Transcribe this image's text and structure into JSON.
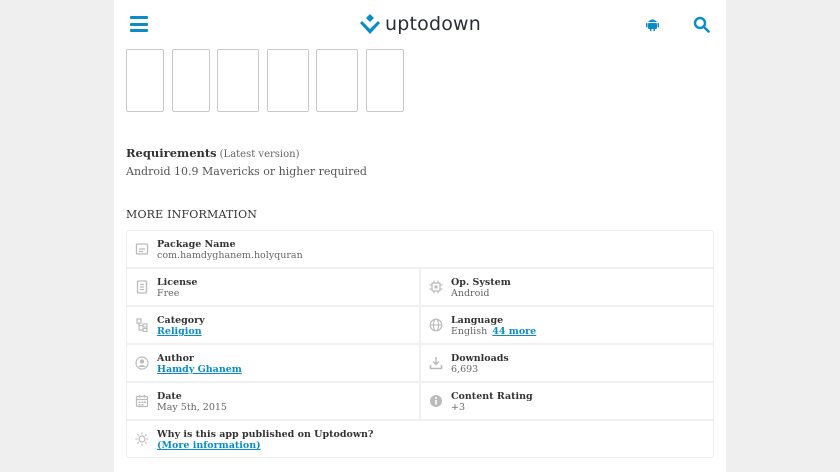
{
  "header": {
    "logo_text": "uptodown",
    "accent_color": "#0a8dc7"
  },
  "screenshots_count": 6,
  "requirements": {
    "title": "Requirements",
    "subtitle": "(Latest version)",
    "text": "Android 10.9 Mavericks or higher required"
  },
  "more_info": {
    "title": "MORE INFORMATION",
    "package_label": "Package Name",
    "package_value": "com.hamdyghanem.holyquran",
    "license_label": "License",
    "license_value": "Free",
    "os_label": "Op. System",
    "os_value": "Android",
    "category_label": "Category",
    "category_value": "Religion",
    "language_label": "Language",
    "language_value": "English",
    "language_more": "44 more",
    "author_label": "Author",
    "author_value": "Hamdy Ghanem",
    "downloads_label": "Downloads",
    "downloads_value": "6,693",
    "date_label": "Date",
    "date_value": "May 5th, 2015",
    "rating_label": "Content Rating",
    "rating_value": "+3",
    "why_label": "Why is this app published on Uptodown?",
    "why_link": "(More information)"
  }
}
